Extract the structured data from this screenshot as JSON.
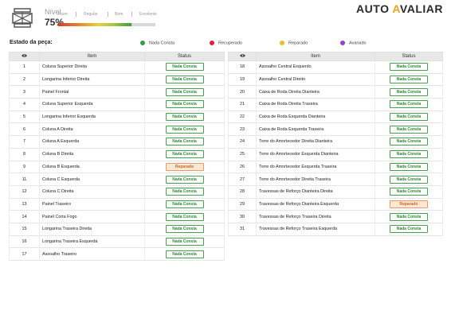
{
  "header": {
    "nivel_title": "Nível",
    "nivel_percent": "75%",
    "nivel_value": 0.75,
    "scale": [
      "Ruim",
      "Regular",
      "Bom",
      "Excelente"
    ],
    "brand_prefix": "AUTO",
    "brand_a": "A",
    "brand_suffix": "VALIAR"
  },
  "legend": {
    "title": "Estado da peça:",
    "items": [
      {
        "label": "Nada Consta",
        "color": "#2e9e48"
      },
      {
        "label": "Recuperado",
        "color": "#e5213a"
      },
      {
        "label": "Reparado",
        "color": "#f5b82a"
      },
      {
        "label": "Avariado",
        "color": "#9b3fd1"
      }
    ]
  },
  "table_headers": {
    "item": "Item",
    "status": "Status"
  },
  "status_colors": {
    "nada_consta": "#46a34d",
    "reparado": "#e99b63"
  },
  "left_rows": [
    {
      "n": "1",
      "item": "Coluna Superior Direita",
      "status": "Nada Consta"
    },
    {
      "n": "2",
      "item": "Longarina Inferior Direita",
      "status": "Nada Consta"
    },
    {
      "n": "3",
      "item": "Painel Frontal",
      "status": "Nada Consta"
    },
    {
      "n": "4",
      "item": "Coluna Superior Esquerda",
      "status": "Nada Consta"
    },
    {
      "n": "5",
      "item": "Longarina Inferior Esquerda",
      "status": "Nada Consta"
    },
    {
      "n": "6",
      "item": "Coluna A Direita",
      "status": "Nada Consta"
    },
    {
      "n": "7",
      "item": "Coluna A Esquerda",
      "status": "Nada Consta"
    },
    {
      "n": "8",
      "item": "Coluna B Direita",
      "status": "Nada Consta"
    },
    {
      "n": "9",
      "item": "Coluna B Esquerda",
      "status": "Reparado"
    },
    {
      "n": "11",
      "item": "Coluna C Esquerda",
      "status": "Nada Consta"
    },
    {
      "n": "12",
      "item": "Coluna C Direita",
      "status": "Nada Consta"
    },
    {
      "n": "13",
      "item": "Painel Traseiro",
      "status": "Nada Consta"
    },
    {
      "n": "14",
      "item": "Painel Corta Fogo",
      "status": "Nada Consta"
    },
    {
      "n": "15",
      "item": "Longarina Traseira Direita",
      "status": "Nada Consta"
    },
    {
      "n": "16",
      "item": "Longarina Traseira Esquerda",
      "status": "Nada Consta"
    },
    {
      "n": "17",
      "item": "Assoalho Traseiro",
      "status": "Nada Consta"
    }
  ],
  "right_rows": [
    {
      "n": "18",
      "item": "Assoalho Central Esquerdo",
      "status": "Nada Consta"
    },
    {
      "n": "19",
      "item": "Assoalho Central Direito",
      "status": "Nada Consta"
    },
    {
      "n": "20",
      "item": "Caixa de Roda Direita Dianteira",
      "status": "Nada Consta"
    },
    {
      "n": "21",
      "item": "Caixa de Roda Direita Traseira",
      "status": "Nada Consta"
    },
    {
      "n": "22",
      "item": "Caixa de Roda Esquerda Dianteira",
      "status": "Nada Consta"
    },
    {
      "n": "23",
      "item": "Caixa de Roda Esquerda Traseira",
      "status": "Nada Consta"
    },
    {
      "n": "24",
      "item": "Torre do Amortecedor Direita Dianteira",
      "status": "Nada Consta"
    },
    {
      "n": "25",
      "item": "Torre do Amortecedor Esquerda Dianteira",
      "status": "Nada Consta"
    },
    {
      "n": "26",
      "item": "Torre do Amortecedor Esquerda Traseira",
      "status": "Nada Consta"
    },
    {
      "n": "27",
      "item": "Torre do Amortecedor Direita Traseira",
      "status": "Nada Consta"
    },
    {
      "n": "28",
      "item": "Travessas de Reforço Dianteira Direita",
      "status": "Nada Consta"
    },
    {
      "n": "29",
      "item": "Travessas de Reforço Dianteira Esquerda",
      "status": "Reparado"
    },
    {
      "n": "30",
      "item": "Travessas de Reforço Traseira Direita",
      "status": "Nada Consta"
    },
    {
      "n": "31",
      "item": "Travessas de Reforço Traseira Esquerda",
      "status": "Nada Consta"
    }
  ]
}
